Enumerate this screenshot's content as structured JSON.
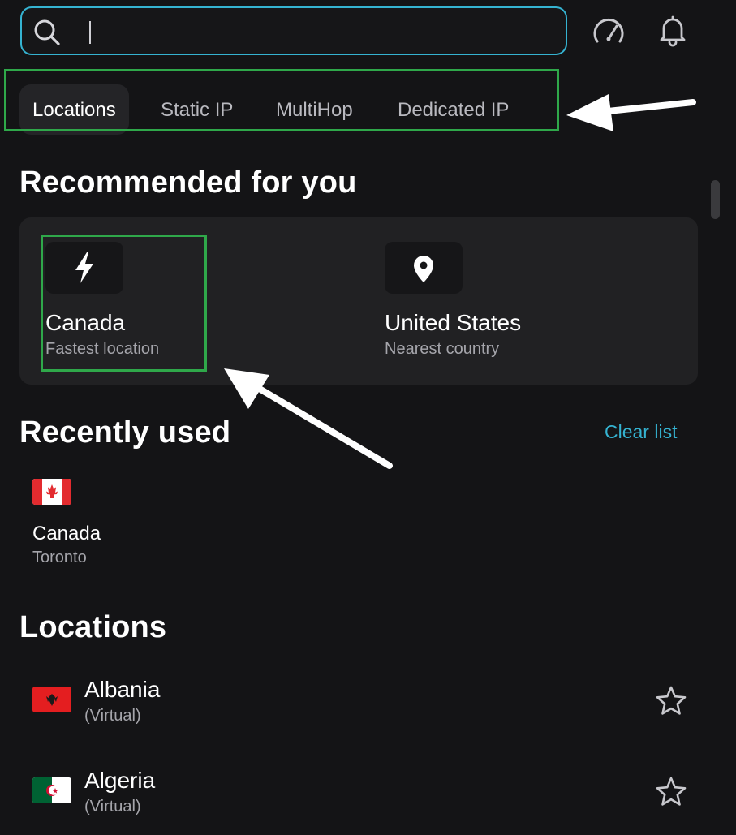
{
  "search": {
    "value": "",
    "placeholder": ""
  },
  "header_icons": {
    "speed": "speedometer-icon",
    "notify": "bell-icon"
  },
  "tabs": [
    {
      "label": "Locations",
      "active": true
    },
    {
      "label": "Static IP"
    },
    {
      "label": "MultiHop"
    },
    {
      "label": "Dedicated IP"
    }
  ],
  "recommended": {
    "title": "Recommended for you",
    "items": [
      {
        "icon": "lightning-icon",
        "name": "Canada",
        "sub": "Fastest location"
      },
      {
        "icon": "location-pin-icon",
        "name": "United States",
        "sub": "Nearest country"
      }
    ]
  },
  "recent": {
    "title": "Recently used",
    "clear_label": "Clear list",
    "items": [
      {
        "flag": "canada-flag-icon",
        "name": "Canada",
        "sub": "Toronto"
      }
    ]
  },
  "locations": {
    "title": "Locations",
    "items": [
      {
        "flag": "albania-flag-icon",
        "name": "Albania",
        "sub": "(Virtual)"
      },
      {
        "flag": "algeria-flag-icon",
        "name": "Algeria",
        "sub": "(Virtual)"
      }
    ]
  },
  "colors": {
    "background": "#141416",
    "accent": "#35b3d1",
    "highlight": "#2fa84a",
    "card": "#212123"
  }
}
